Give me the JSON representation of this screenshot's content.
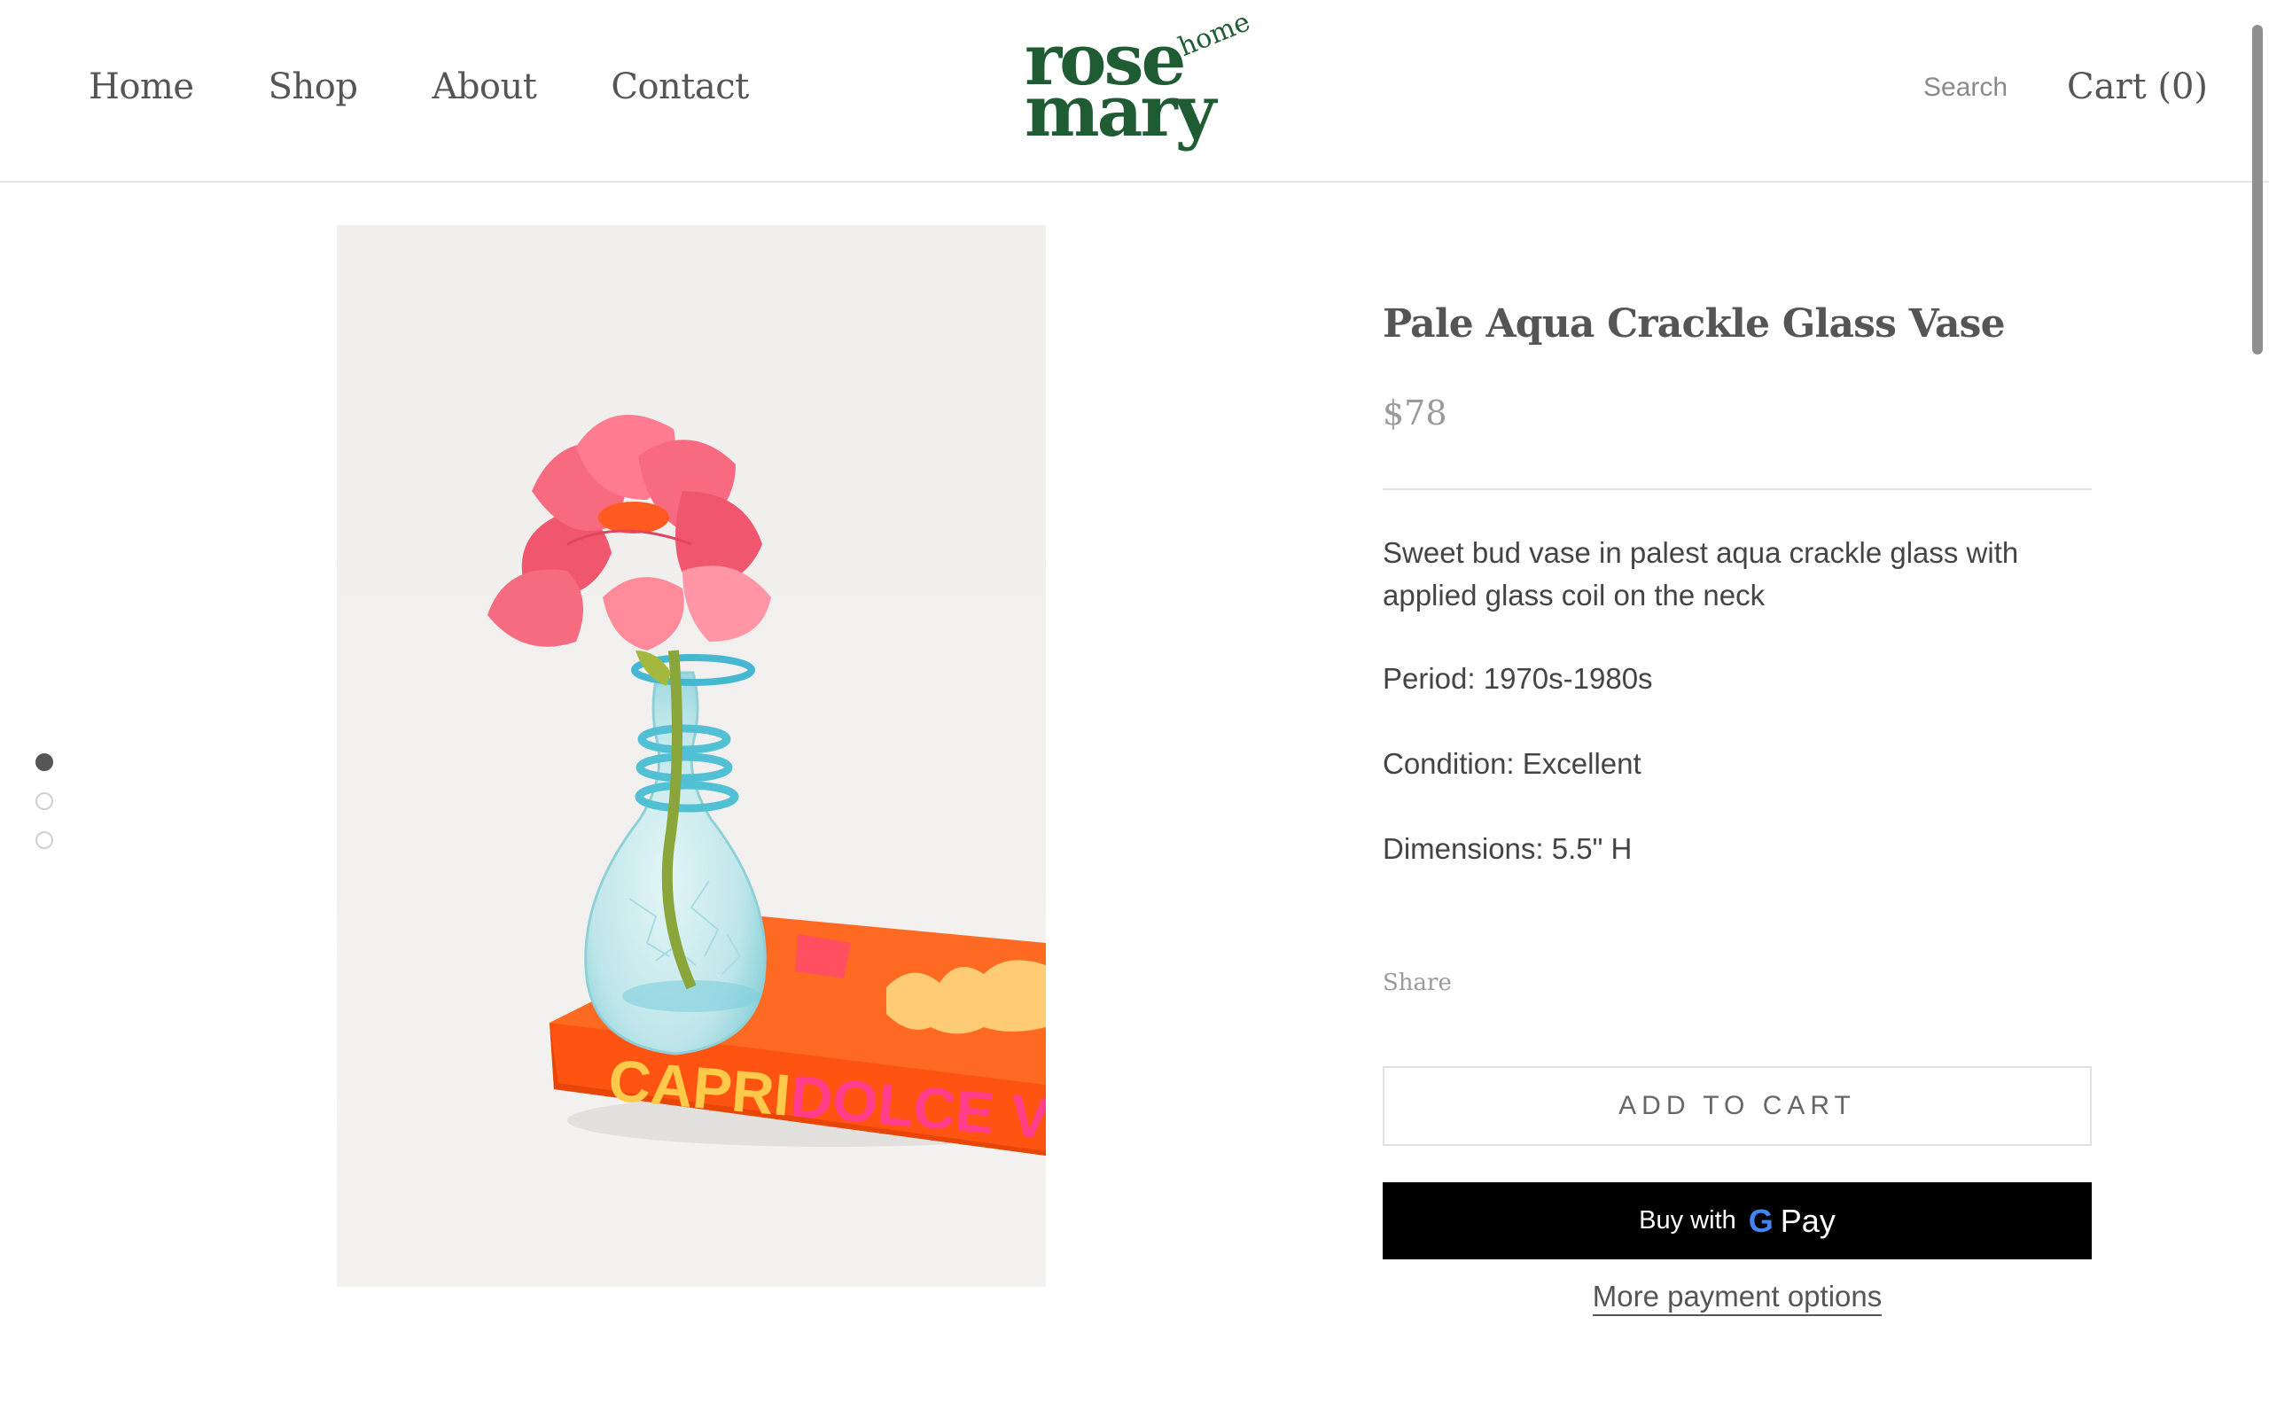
{
  "header": {
    "nav": [
      {
        "label": "Home"
      },
      {
        "label": "Shop"
      },
      {
        "label": "About"
      },
      {
        "label": "Contact"
      }
    ],
    "logo": {
      "line1": "rose",
      "line2": "mary",
      "accent": "home",
      "color": "#1f5c34"
    },
    "search_label": "Search",
    "cart_label": "Cart (0)"
  },
  "gallery": {
    "image_count": 3,
    "active_index": 0,
    "book_spine_title": "CAPRI",
    "book_spine_subtitle": "DOLCE VI"
  },
  "product": {
    "title": "Pale Aqua Crackle Glass Vase",
    "price": "$78",
    "description": "Sweet bud vase in palest aqua crackle glass with applied glass coil on the neck",
    "period": "Period: 1970s-1980s",
    "condition": "Condition: Excellent",
    "dimensions": "Dimensions: 5.5\" H",
    "share_label": "Share",
    "add_to_cart_label": "ADD TO CART",
    "gpay": {
      "buy_with": "Buy with",
      "g": "G",
      "pay": "Pay"
    },
    "more_payment_label": "More payment options"
  },
  "colors": {
    "brand_green": "#1f5c34",
    "gpay_bg": "#000000",
    "book_orange": "#ff5a1f",
    "book_yellow": "#ffc94a",
    "book_pink": "#ff3d8a",
    "flower_pink": "#f2617a"
  }
}
